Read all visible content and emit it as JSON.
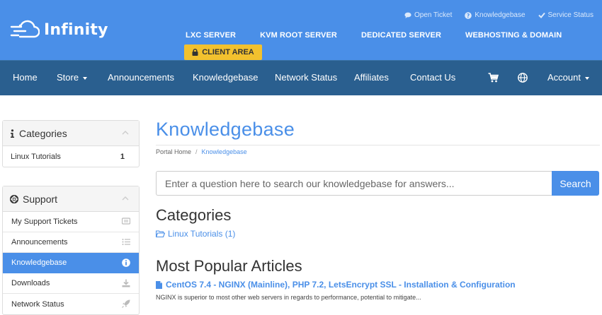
{
  "brand": {
    "name": "Infinity"
  },
  "top_links": [
    {
      "label": "Open Ticket",
      "icon": "chat-bubble-icon"
    },
    {
      "label": "Knowledgebase",
      "icon": "question-circle-icon"
    },
    {
      "label": "Service Status",
      "icon": "checkmark-icon"
    }
  ],
  "main_links": [
    "LXC SERVER",
    "KVM ROOT SERVER",
    "DEDICATED SERVER",
    "WEBHOSTING & DOMAIN"
  ],
  "client_area": {
    "label": "CLIENT AREA",
    "icon": "lock-icon"
  },
  "nav": {
    "home": "Home",
    "store": "Store",
    "announcements": "Announcements",
    "knowledgebase": "Knowledgebase",
    "network_status": "Network Status",
    "affiliates": "Affiliates",
    "contact": "Contact Us",
    "account": "Account"
  },
  "sidebar": {
    "categories": {
      "title": "Categories",
      "items": [
        {
          "label": "Linux Tutorials",
          "count": "1"
        }
      ]
    },
    "support": {
      "title": "Support",
      "items": [
        {
          "label": "My Support Tickets",
          "icon": "ticket-icon"
        },
        {
          "label": "Announcements",
          "icon": "list-icon"
        },
        {
          "label": "Knowledgebase",
          "icon": "info-circle-icon"
        },
        {
          "label": "Downloads",
          "icon": "download-icon"
        },
        {
          "label": "Network Status",
          "icon": "rocket-icon"
        }
      ]
    }
  },
  "main": {
    "title": "Knowledgebase",
    "breadcrumb": [
      "Portal Home",
      "Knowledgebase"
    ],
    "search": {
      "placeholder": "Enter a question here to search our knowledgebase for answers...",
      "button": "Search"
    },
    "categories_title": "Categories",
    "category_link": "Linux Tutorials (1)",
    "popular_title": "Most Popular Articles",
    "article": {
      "title": "CentOS 7.4 - NGINX (Mainline), PHP 7.2, LetsEncrypt SSL - Installation & Configuration",
      "description": "NGINX is superior to most other web servers in regards to performance, potential to mitigate..."
    }
  },
  "colors": {
    "brand_blue": "#4a8fe8",
    "nav_dark_blue": "#2a5f8f",
    "client_area_yellow": "#f2c12e",
    "active_item": "#4a8fe8"
  }
}
